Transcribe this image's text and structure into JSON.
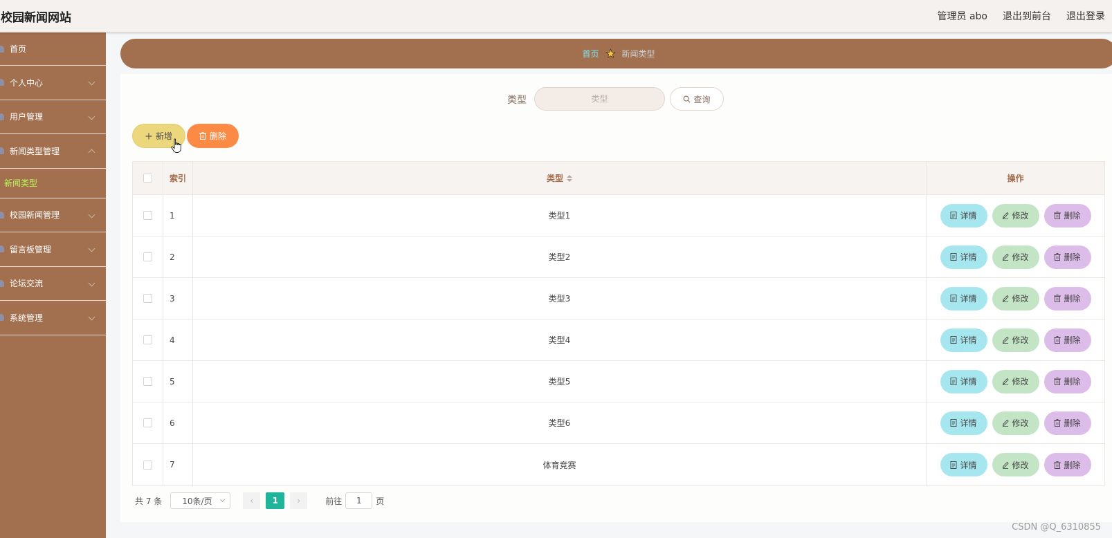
{
  "header": {
    "title": "校园新闻网站",
    "links": [
      "管理员 abo",
      "退出到前台",
      "退出登录"
    ]
  },
  "sidebar": {
    "items": [
      {
        "label": "首页",
        "expandable": false
      },
      {
        "label": "个人中心",
        "expandable": true
      },
      {
        "label": "用户管理",
        "expandable": true
      },
      {
        "label": "新闻类型管理",
        "expandable": true,
        "expanded": true,
        "children": [
          "新闻类型"
        ]
      },
      {
        "label": "校园新闻管理",
        "expandable": true
      },
      {
        "label": "留言板管理",
        "expandable": true
      },
      {
        "label": "论坛交流",
        "expandable": true
      },
      {
        "label": "系统管理",
        "expandable": true
      }
    ]
  },
  "breadcrumb": {
    "home": "首页",
    "current": "新闻类型"
  },
  "search": {
    "label": "类型",
    "placeholder": "类型",
    "value": "",
    "query_label": "查询"
  },
  "actions": {
    "add_label": "新增",
    "delete_label": "删除"
  },
  "table": {
    "headers": {
      "index": "索引",
      "type": "类型",
      "ops": "操作"
    },
    "rows": [
      {
        "index": "1",
        "type": "类型1"
      },
      {
        "index": "2",
        "type": "类型2"
      },
      {
        "index": "3",
        "type": "类型3"
      },
      {
        "index": "4",
        "type": "类型4"
      },
      {
        "index": "5",
        "type": "类型5"
      },
      {
        "index": "6",
        "type": "类型6"
      },
      {
        "index": "7",
        "type": "体育竞赛"
      }
    ],
    "row_actions": {
      "detail": "详情",
      "edit": "修改",
      "delete": "删除"
    }
  },
  "pagination": {
    "total": "共 7 条",
    "page_size": "10条/页",
    "current_page": "1",
    "goto_label": "前往",
    "goto_value": "1",
    "page_suffix": "页"
  },
  "watermark": "CSDN @Q_6310855",
  "colors": {
    "sidebar": "#a3704f",
    "active_submenu": "#b9f25a",
    "add_button": "#ecd77d",
    "delete_button": "#fb8a45",
    "detail_button": "#a6e6ef",
    "edit_button": "#c3e5c6",
    "row_delete_button": "#dcbde9",
    "pager_active": "#1fb59a"
  },
  "icons": {
    "query": "search-icon",
    "add": "plus-icon",
    "delete": "trash-icon",
    "detail": "document-icon",
    "edit": "pencil-icon",
    "breadcrumb_separator": "star-icon"
  }
}
